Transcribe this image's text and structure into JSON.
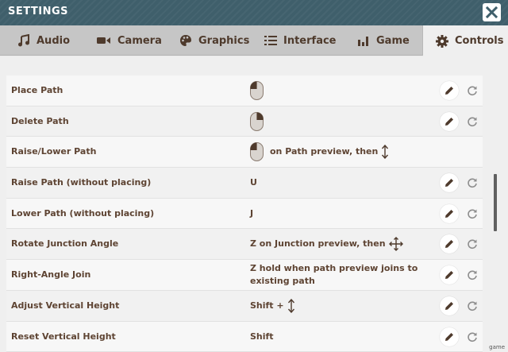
{
  "window": {
    "title": "SETTINGS",
    "close_icon": "close-icon"
  },
  "tabs": [
    {
      "label": "Audio",
      "icon": "music-note-icon",
      "active": false
    },
    {
      "label": "Camera",
      "icon": "video-camera-icon",
      "active": false
    },
    {
      "label": "Graphics",
      "icon": "palette-icon",
      "active": false
    },
    {
      "label": "Interface",
      "icon": "list-icon",
      "active": false
    },
    {
      "label": "Game",
      "icon": "bar-chart-icon",
      "active": false
    },
    {
      "label": "Controls",
      "icon": "gear-icon",
      "active": true
    }
  ],
  "bindings": [
    {
      "action": "Place Path",
      "value_icon": "mouse-left-click-icon",
      "value_text": "",
      "editable": true
    },
    {
      "action": "Delete Path",
      "value_icon": "mouse-right-click-icon",
      "value_text": "",
      "editable": true
    },
    {
      "action": "Raise/Lower Path",
      "value_icon": "mouse-left-click-icon",
      "value_text": "on Path preview, then",
      "value_suffix_icon": "vertical-drag-icon",
      "editable": false
    },
    {
      "action": "Raise Path (without placing)",
      "value_text": "U",
      "editable": true
    },
    {
      "action": "Lower Path (without placing)",
      "value_text": "J",
      "editable": true
    },
    {
      "action": "Rotate Junction Angle",
      "value_text": "Z on Junction preview, then",
      "value_suffix_icon": "move-arrows-icon",
      "editable": true
    },
    {
      "action": "Right-Angle Join",
      "value_text": "Z hold when path preview joins to existing path",
      "editable": true
    },
    {
      "action": "Adjust Vertical Height",
      "value_text": "Shift +",
      "value_suffix_icon": "vertical-drag-icon",
      "editable": true
    },
    {
      "action": "Reset Vertical Height",
      "value_text": "Shift",
      "editable": true
    }
  ],
  "row_buttons": {
    "edit_icon": "pencil-icon",
    "reset_icon": "reset-icon"
  },
  "watermark": "game"
}
